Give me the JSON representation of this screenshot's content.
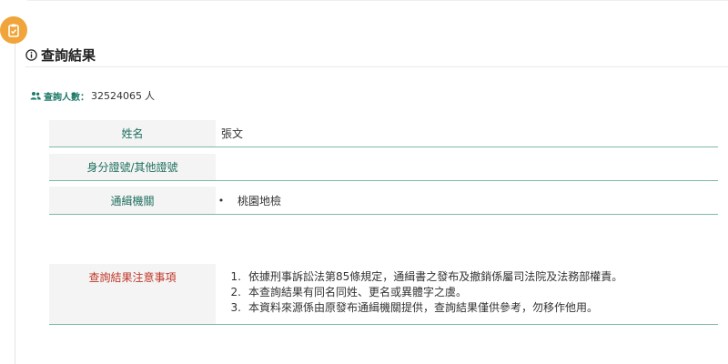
{
  "header": {
    "title": "查詢結果"
  },
  "summary": {
    "label": "查詢人數：",
    "count": "32524065",
    "unit": "人"
  },
  "result": {
    "rows": [
      {
        "label": "姓名",
        "value": "張文"
      },
      {
        "label": "身分證號/其他證號",
        "value": ""
      },
      {
        "label": "通緝機關",
        "bullet": "•",
        "value": "桃園地檢"
      }
    ],
    "notes": {
      "label": "查詢結果注意事項",
      "items": [
        {
          "num": "1.",
          "text": "依據刑事訴訟法第85條規定，通緝書之發布及撤銷係屬司法院及法務部權責。"
        },
        {
          "num": "2.",
          "text": "本查詢結果有同名同姓、更名或異體字之虞。"
        },
        {
          "num": "3.",
          "text": "本資料來源係由原發布通緝機關提供，查詢結果僅供參考，勿移作他用。"
        }
      ]
    }
  },
  "colors": {
    "accent": "#1e6f5f",
    "warning": "#c0392b",
    "badge": "#f0a43a",
    "rule": "#7fb7a9"
  },
  "icons": {
    "badge": "clipboard-icon",
    "title": "info-icon",
    "summary": "users-icon"
  }
}
